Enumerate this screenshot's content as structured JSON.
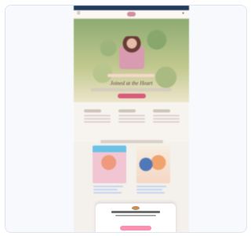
{
  "page": {
    "announcement": "",
    "hero_headline": "Joined at the Heart"
  },
  "features": [
    {
      "title": ""
    },
    {
      "title": ""
    },
    {
      "title": ""
    }
  ],
  "modal": {
    "title": "",
    "subtitle": "",
    "button": "",
    "link": ""
  },
  "icons": {
    "menu": "menu-icon",
    "cart": "cart-icon",
    "logo": "brand-logo"
  },
  "colors": {
    "announcement_bar": "#203a5c",
    "accent": "#d95b7b",
    "modal_button": "#ff8fb1"
  }
}
